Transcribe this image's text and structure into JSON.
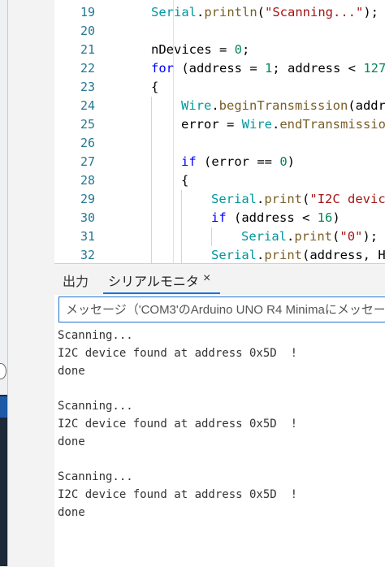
{
  "editor": {
    "lines": [
      {
        "num": "19",
        "tokens": [
          {
            "t": "Serial",
            "c": "k-class"
          },
          {
            "t": ".",
            "c": ""
          },
          {
            "t": "println",
            "c": "k-func"
          },
          {
            "t": "(",
            "c": ""
          },
          {
            "t": "\"Scanning...\"",
            "c": "k-str"
          },
          {
            "t": ");",
            "c": ""
          }
        ],
        "indent": 0
      },
      {
        "num": "20",
        "tokens": [],
        "indent": 0
      },
      {
        "num": "21",
        "tokens": [
          {
            "t": "nDevices = ",
            "c": ""
          },
          {
            "t": "0",
            "c": "k-num"
          },
          {
            "t": ";",
            "c": ""
          }
        ],
        "indent": 0
      },
      {
        "num": "22",
        "tokens": [
          {
            "t": "for",
            "c": "k-keyword"
          },
          {
            "t": " (address = ",
            "c": ""
          },
          {
            "t": "1",
            "c": "k-num"
          },
          {
            "t": "; address < ",
            "c": ""
          },
          {
            "t": "127",
            "c": "k-num"
          },
          {
            "t": ";",
            "c": ""
          }
        ],
        "indent": 0
      },
      {
        "num": "23",
        "tokens": [
          {
            "t": "{",
            "c": ""
          }
        ],
        "indent": 0
      },
      {
        "num": "24",
        "tokens": [
          {
            "t": "Wire",
            "c": "k-class"
          },
          {
            "t": ".",
            "c": ""
          },
          {
            "t": "beginTransmission",
            "c": "k-func"
          },
          {
            "t": "(addr",
            "c": ""
          }
        ],
        "indent": 1
      },
      {
        "num": "25",
        "tokens": [
          {
            "t": "error = ",
            "c": ""
          },
          {
            "t": "Wire",
            "c": "k-class"
          },
          {
            "t": ".",
            "c": ""
          },
          {
            "t": "endTransmissio",
            "c": "k-func"
          }
        ],
        "indent": 1
      },
      {
        "num": "26",
        "tokens": [],
        "indent": 1
      },
      {
        "num": "27",
        "tokens": [
          {
            "t": "if",
            "c": "k-keyword"
          },
          {
            "t": " (error == ",
            "c": ""
          },
          {
            "t": "0",
            "c": "k-num"
          },
          {
            "t": ")",
            "c": ""
          }
        ],
        "indent": 1
      },
      {
        "num": "28",
        "tokens": [
          {
            "t": "{",
            "c": ""
          }
        ],
        "indent": 1
      },
      {
        "num": "29",
        "tokens": [
          {
            "t": "Serial",
            "c": "k-class"
          },
          {
            "t": ".",
            "c": ""
          },
          {
            "t": "print",
            "c": "k-func"
          },
          {
            "t": "(",
            "c": ""
          },
          {
            "t": "\"I2C devic",
            "c": "k-str"
          }
        ],
        "indent": 2
      },
      {
        "num": "30",
        "tokens": [
          {
            "t": "if",
            "c": "k-keyword"
          },
          {
            "t": " (address < ",
            "c": ""
          },
          {
            "t": "16",
            "c": "k-num"
          },
          {
            "t": ")",
            "c": ""
          }
        ],
        "indent": 2
      },
      {
        "num": "31",
        "tokens": [
          {
            "t": "Serial",
            "c": "k-class"
          },
          {
            "t": ".",
            "c": ""
          },
          {
            "t": "print",
            "c": "k-func"
          },
          {
            "t": "(",
            "c": ""
          },
          {
            "t": "\"0\"",
            "c": "k-str"
          },
          {
            "t": ");",
            "c": ""
          }
        ],
        "indent": 3
      },
      {
        "num": "32",
        "tokens": [
          {
            "t": "Serial",
            "c": "k-class"
          },
          {
            "t": ".",
            "c": ""
          },
          {
            "t": "print",
            "c": "k-func"
          },
          {
            "t": "(address, H",
            "c": ""
          }
        ],
        "indent": 2
      }
    ]
  },
  "panel": {
    "tab_output": "出力",
    "tab_serial": "シリアルモニタ",
    "tab_close": "×",
    "input_placeholder": "メッセージ（'COM3'のArduino UNO R4 Minimaにメッセー",
    "console_blocks": [
      [
        "Scanning...",
        "I2C device found at address 0x5D  !",
        "done"
      ],
      [
        "Scanning...",
        "I2C device found at address 0x5D  !",
        "done"
      ],
      [
        "Scanning...",
        "I2C device found at address 0x5D  !",
        "done"
      ]
    ]
  },
  "colors": {
    "accent": "#1b73d6",
    "keyword": "#0000ff",
    "class": "#00979d",
    "function": "#795e26",
    "number": "#098658",
    "string": "#a31515",
    "line_number": "#237893"
  }
}
